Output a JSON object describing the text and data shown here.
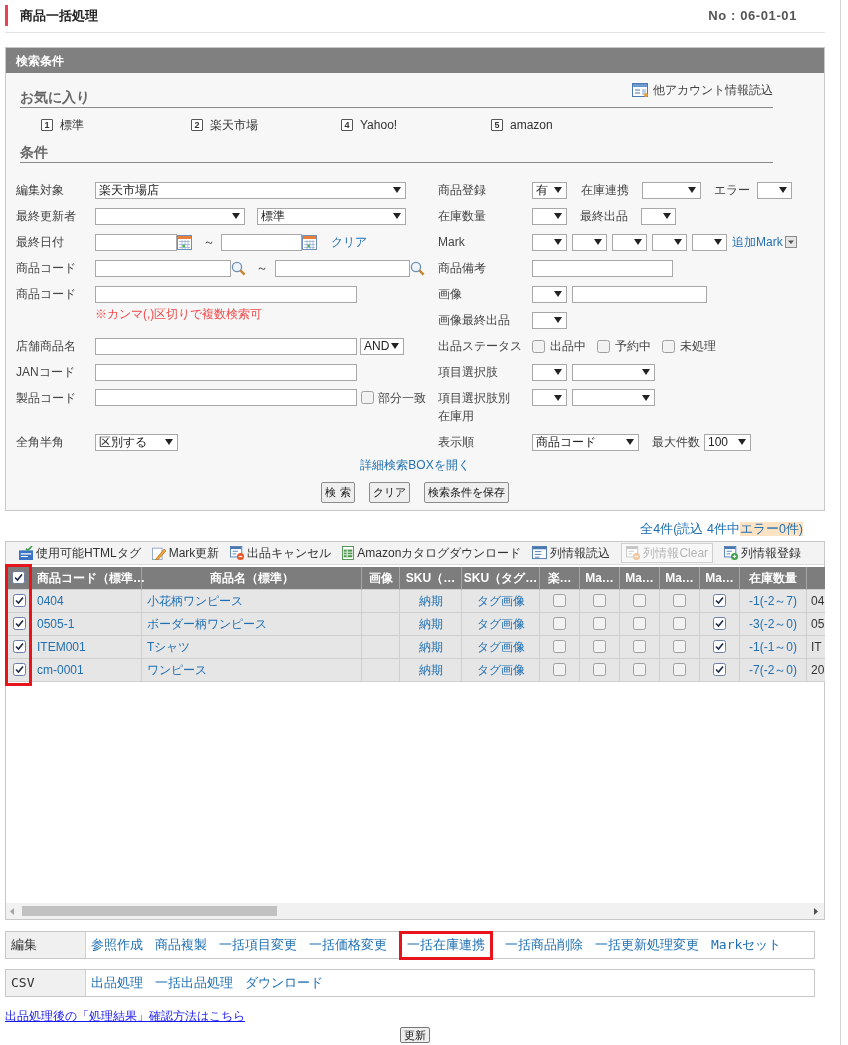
{
  "header": {
    "title": "商品一括処理",
    "number": "No : 06-01-01"
  },
  "search": {
    "title": "検索条件",
    "favorites": {
      "heading": "お気に入り",
      "account_link": "他アカウント情報読込",
      "items": [
        {
          "key": "1",
          "label": "標準"
        },
        {
          "key": "2",
          "label": "楽天市場"
        },
        {
          "key": "4",
          "label": "Yahoo!"
        },
        {
          "key": "5",
          "label": "amazon"
        }
      ]
    },
    "conditions": {
      "heading": "条件",
      "edit_target": {
        "label": "編集対象",
        "value": "楽天市場店"
      },
      "last_updater": {
        "label": "最終更新者",
        "template": "標準"
      },
      "last_date": {
        "label": "最終日付",
        "range_sign": "～",
        "clear_link": "クリア"
      },
      "code_range": {
        "label": "商品コード",
        "range_sign": "～"
      },
      "code_list": {
        "label": "商品コード",
        "note": "※カンマ(,)区切りで複数検索可"
      },
      "shop_product_name": {
        "label": "店舗商品名",
        "operator": "AND"
      },
      "jan_code": {
        "label": "JANコード"
      },
      "item_code": {
        "label": "製品コード",
        "partial_match": {
          "label": "部分一致",
          "checked": false
        }
      },
      "width_mode": {
        "label": "全角半角",
        "value": "区別する"
      },
      "registration": {
        "label": "商品登録",
        "value": "有",
        "stock_link_label": "在庫連携",
        "error_label": "エラー"
      },
      "stock_quantity": {
        "label": "在庫数量",
        "last_listing_label": "最終出品"
      },
      "mark": {
        "label": "Mark",
        "add_link": "追加Mark"
      },
      "product_note": {
        "label": "商品備考"
      },
      "image": {
        "label": "画像"
      },
      "image_last_listing": {
        "label": "画像最終出品"
      },
      "listing_status": {
        "label": "出品ステータス",
        "options": [
          {
            "label": "出品中",
            "checked": false
          },
          {
            "label": "予約中",
            "checked": false
          },
          {
            "label": "未処理",
            "checked": false
          }
        ]
      },
      "option_items": {
        "label": "項目選択肢"
      },
      "option_stock": {
        "label_lines": [
          "項目選択肢別",
          "在庫用"
        ]
      },
      "sort_order": {
        "label": "表示順",
        "value": "商品コード",
        "max_label": "最大件数",
        "max_value": "100"
      }
    },
    "detail_link": "詳細検索BOXを開く",
    "buttons": [
      "検 索",
      "クリア",
      "検索条件を保存"
    ]
  },
  "summary": {
    "text": "全4件(読込 4件中",
    "errors": "エラー0件)"
  },
  "toolbar": [
    {
      "label": "使用可能HTMLタグ",
      "disabled": false
    },
    {
      "label": "Mark更新",
      "disabled": false
    },
    {
      "label": "出品キャンセル",
      "disabled": false
    },
    {
      "label": "Amazonカタログダウンロード",
      "disabled": false
    },
    {
      "label": "列情報読込",
      "disabled": false
    },
    {
      "label": "列情報Clear",
      "disabled": true
    },
    {
      "label": "列情報登録",
      "disabled": false
    }
  ],
  "table": {
    "checkbox_column_highlighted": true,
    "select_all_checked": true,
    "columns": [
      "商品コード（標準…",
      "商品名（標準）",
      "画像",
      "SKU（…",
      "SKU（タグ…",
      "楽…",
      "Ma…",
      "Ma…",
      "Ma…",
      "Ma…",
      "在庫数量"
    ],
    "rows": [
      {
        "selected": true,
        "code": "0404",
        "name": "小花柄ワンピース",
        "sku": "納期",
        "sku_tag": "タグ画像",
        "checks": [
          false,
          false,
          false,
          false,
          true
        ],
        "stock": "-1(-2～7)",
        "column_13": "04"
      },
      {
        "selected": true,
        "code": "0505-1",
        "name": "ボーダー柄ワンピース",
        "sku": "納期",
        "sku_tag": "タグ画像",
        "checks": [
          false,
          false,
          false,
          false,
          true
        ],
        "stock": "-3(-2～0)",
        "column_13": "05"
      },
      {
        "selected": true,
        "code": "ITEM001",
        "name": "Tシャツ",
        "sku": "納期",
        "sku_tag": "タグ画像",
        "checks": [
          false,
          false,
          false,
          false,
          true
        ],
        "stock": "-1(-1～0)",
        "column_13": "IT"
      },
      {
        "selected": true,
        "code": "cm-0001",
        "name": "ワンピース",
        "sku": "納期",
        "sku_tag": "タグ画像",
        "checks": [
          false,
          false,
          false,
          false,
          true
        ],
        "stock": "-7(-2～0)",
        "column_13": "20"
      }
    ]
  },
  "edit_bar": {
    "label": "編集",
    "links": [
      {
        "label": "参照作成",
        "highlighted": false
      },
      {
        "label": "商品複製",
        "highlighted": false
      },
      {
        "label": "一括項目変更",
        "highlighted": false
      },
      {
        "label": "一括価格変更",
        "highlighted": false
      },
      {
        "label": "一括在庫連携",
        "highlighted": true
      },
      {
        "label": "一括商品削除",
        "highlighted": false
      },
      {
        "label": "一括更新処理変更",
        "highlighted": false
      },
      {
        "label": "Markセット",
        "highlighted": false
      }
    ]
  },
  "csv_bar": {
    "label": "CSV",
    "links": [
      "出品処理",
      "一括出品処理",
      "ダウンロード"
    ]
  },
  "help_link": "出品処理後の「処理結果」確認方法はこちら",
  "update_button": "更新"
}
